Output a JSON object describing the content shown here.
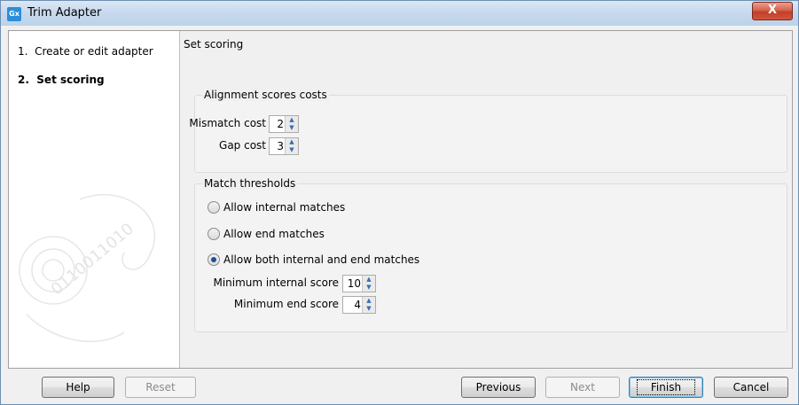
{
  "window": {
    "title": "Trim Adapter",
    "app_icon_text": "Gx",
    "close_glyph": "X"
  },
  "sidebar": {
    "steps": [
      {
        "number": "1.",
        "label": "Create or edit adapter",
        "active": false
      },
      {
        "number": "2.",
        "label": "Set scoring",
        "active": true
      }
    ],
    "watermark_text": "0110011010"
  },
  "main": {
    "heading": "Set scoring",
    "alignment_group": {
      "title": "Alignment scores costs",
      "mismatch_label": "Mismatch cost",
      "mismatch_value": "2",
      "gap_label": "Gap cost",
      "gap_value": "3"
    },
    "match_group": {
      "title": "Match thresholds",
      "options": [
        {
          "label": "Allow internal matches",
          "checked": false
        },
        {
          "label": "Allow end matches",
          "checked": false
        },
        {
          "label": "Allow both internal and end matches",
          "checked": true
        }
      ],
      "min_internal_label": "Minimum internal score",
      "min_internal_value": "10",
      "min_end_label": "Minimum end score",
      "min_end_value": "4"
    }
  },
  "footer": {
    "help": "Help",
    "reset": "Reset",
    "previous": "Previous",
    "next": "Next",
    "finish": "Finish",
    "cancel": "Cancel"
  }
}
